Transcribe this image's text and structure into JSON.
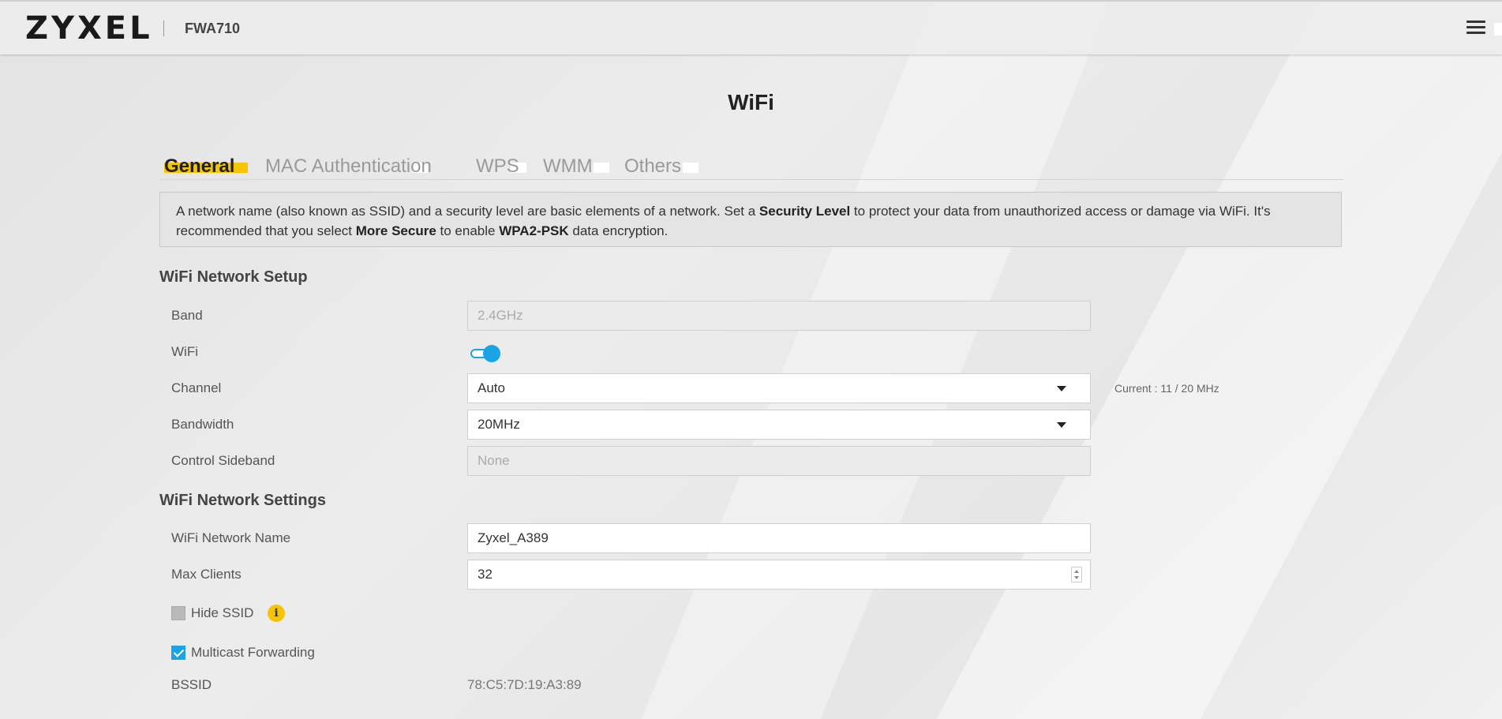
{
  "header": {
    "brand": "ZYXEL",
    "model": "FWA710",
    "menu_icon": "hamburger-icon"
  },
  "page": {
    "title": "WiFi"
  },
  "tabs": [
    {
      "label": "General",
      "active": true
    },
    {
      "label": "MAC Authentication",
      "active": false
    },
    {
      "label": "WPS",
      "active": false
    },
    {
      "label": "WMM",
      "active": false
    },
    {
      "label": "Others",
      "active": false
    }
  ],
  "info": {
    "t1": "A network name (also known as SSID) and a security level are basic elements of a network. Set a ",
    "b1": "Security Level",
    "t2": " to protect your data from unauthorized access or damage via WiFi. It's recommended that you select ",
    "b2": "More Secure",
    "t3": " to enable ",
    "b3": "WPA2-PSK",
    "t4": " data encryption."
  },
  "setup": {
    "title": "WiFi Network Setup",
    "band_label": "Band",
    "band_value": "2.4GHz",
    "wifi_label": "WiFi",
    "wifi_enabled": true,
    "channel_label": "Channel",
    "channel_value": "Auto",
    "channel_current": "Current : 11 / 20 MHz",
    "bandwidth_label": "Bandwidth",
    "bandwidth_value": "20MHz",
    "sideband_label": "Control Sideband",
    "sideband_value": "None"
  },
  "settings": {
    "title": "WiFi Network Settings",
    "name_label": "WiFi Network Name",
    "name_value": "Zyxel_A389",
    "clients_label": "Max Clients",
    "clients_value": "32",
    "hide_ssid_label": "Hide SSID",
    "hide_ssid_checked": false,
    "multicast_label": "Multicast Forwarding",
    "multicast_checked": true,
    "bssid_label": "BSSID",
    "bssid_value": "78:C5:7D:19:A3:89"
  },
  "colors": {
    "accent_blue": "#1aa3e6",
    "accent_yellow": "#f6c400"
  }
}
